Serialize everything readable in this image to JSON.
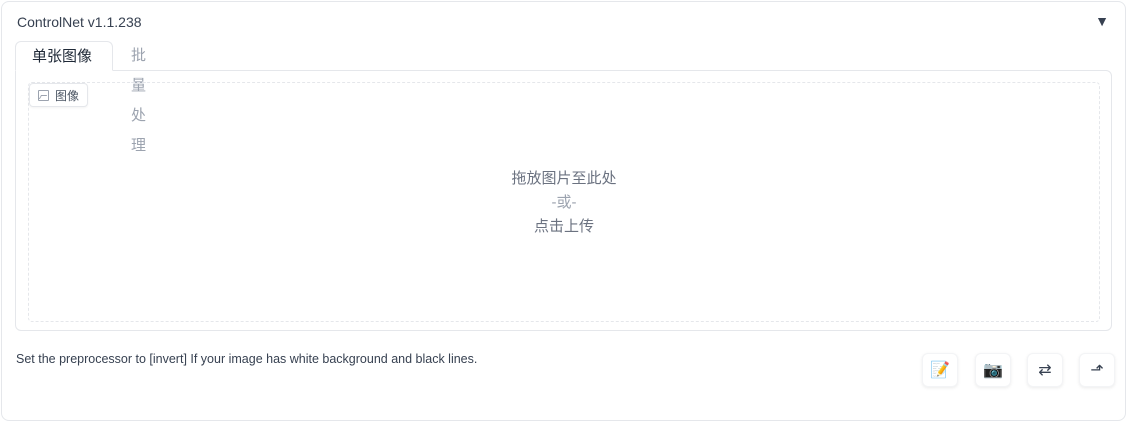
{
  "panel": {
    "title": "ControlNet v1.1.238",
    "collapse_icon": "▼"
  },
  "tabs": [
    {
      "label": "单张图像",
      "active": true
    },
    {
      "label": "批量处理",
      "active": false
    }
  ],
  "image_input": {
    "label": "图像",
    "drop_text": "拖放图片至此处",
    "or_text": "-或-",
    "click_text": "点击上传"
  },
  "hint_text": "Set the preprocessor to [invert] If your image has white background and black lines.",
  "tools": {
    "notes_icon": "📝",
    "camera_icon": "📷",
    "swap_icon": "⇄",
    "send_icon": "⬏"
  }
}
